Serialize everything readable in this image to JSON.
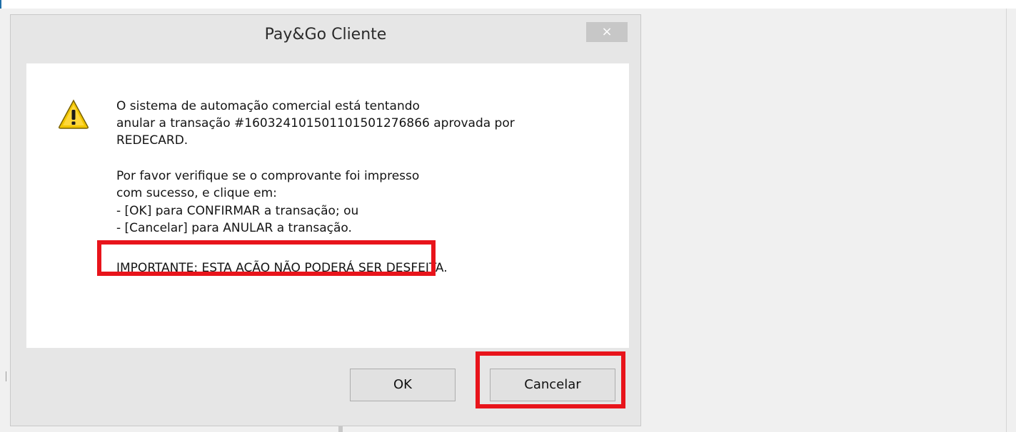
{
  "dialog": {
    "title": "Pay&Go Cliente",
    "close_glyph": "×",
    "icon": "warning-icon",
    "message_lines": [
      "O sistema de automação comercial está tentando",
      "anular a transação #160324101501101501276866 aprovada por",
      "REDECARD.",
      "Por favor verifique se o comprovante foi impresso",
      "com sucesso, e clique em:",
      "- [OK] para CONFIRMAR a transação; ou",
      "- [Cancelar] para ANULAR a transação.",
      "IMPORTANTE: ESTA AÇÃO NÃO PODERÁ SER DESFEITA."
    ],
    "buttons": {
      "ok": "OK",
      "cancel": "Cancelar"
    }
  },
  "colors": {
    "highlight": "#e8141b",
    "warning_fill": "#f2c600"
  }
}
